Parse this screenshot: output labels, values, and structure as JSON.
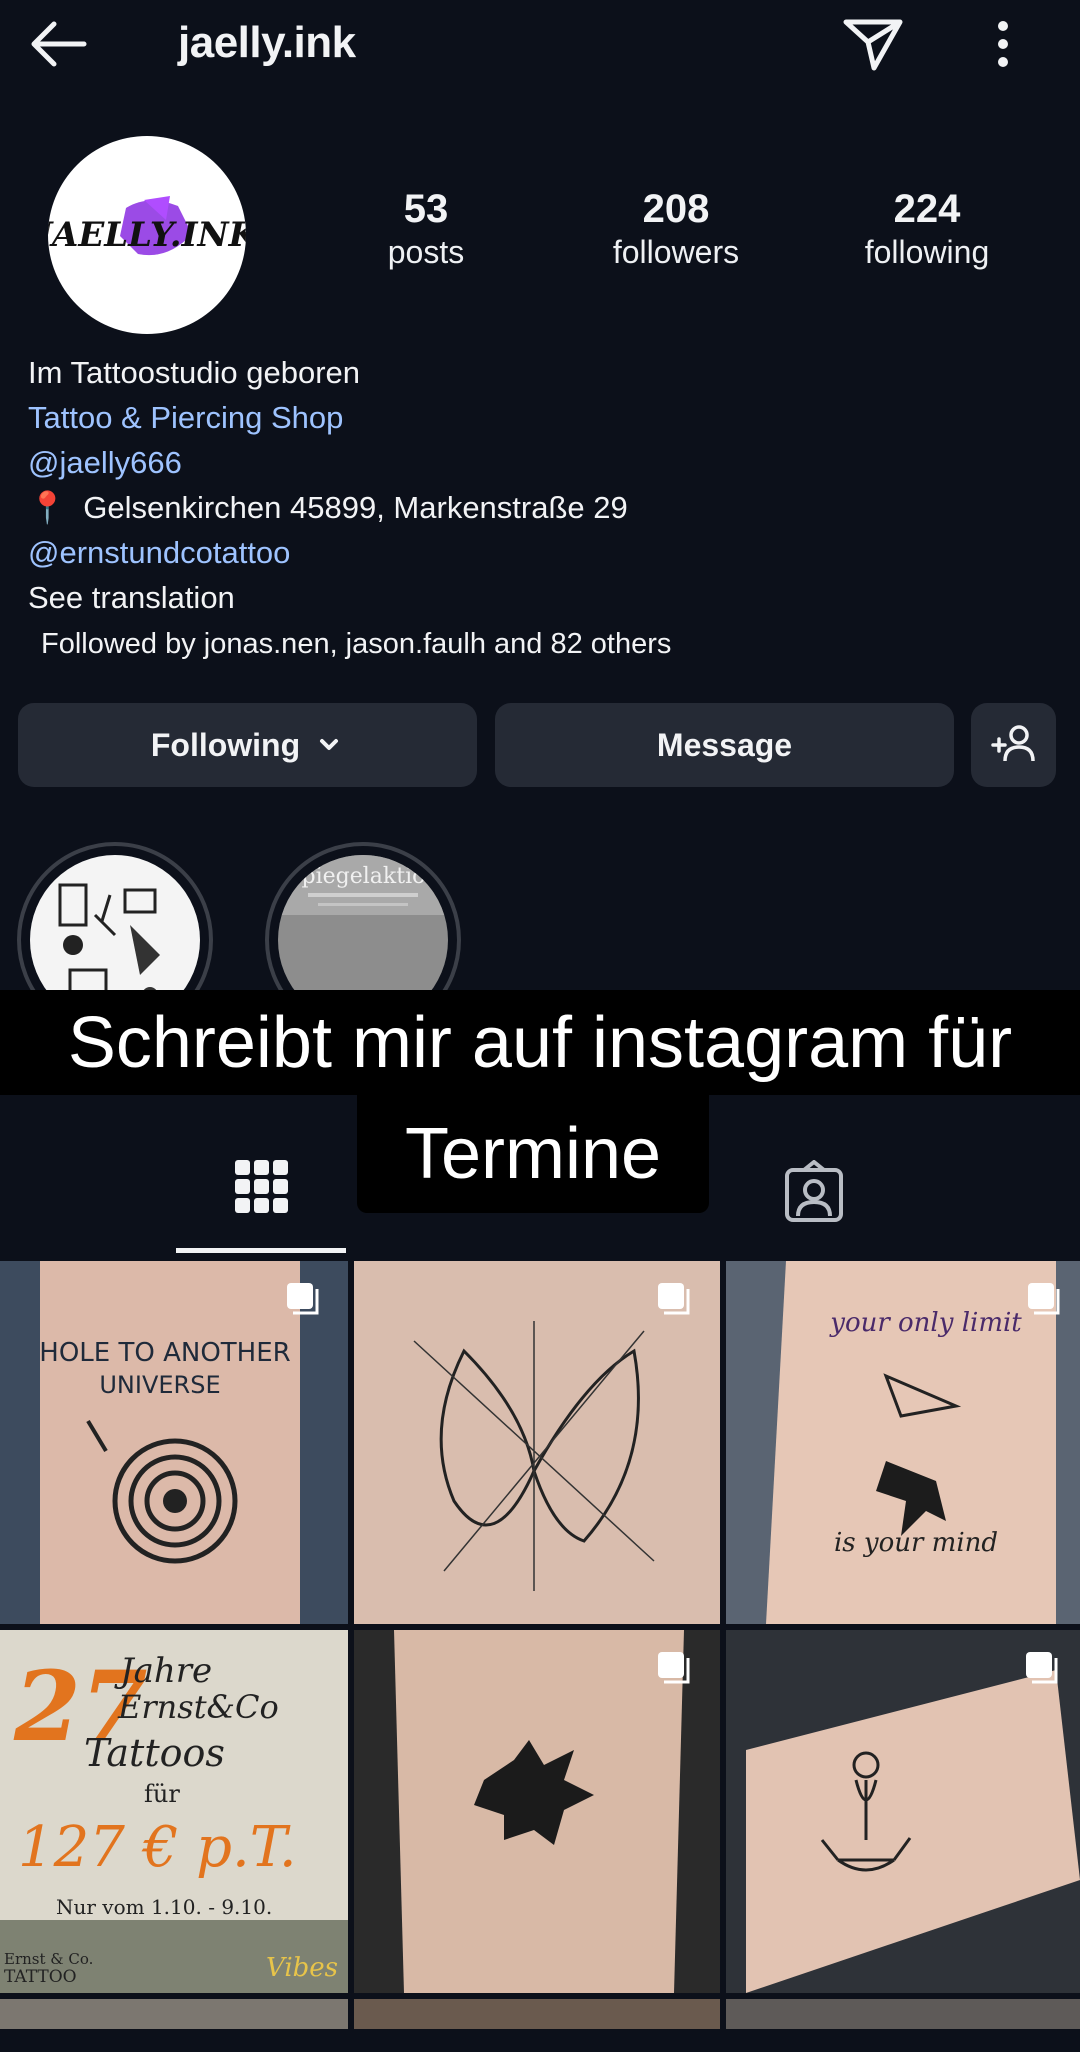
{
  "header": {
    "username": "jaelly.ink",
    "back_icon": "arrow-left-icon",
    "send_icon": "paper-plane-icon",
    "more_icon": "more-vertical-icon"
  },
  "avatar": {
    "logo_text": "JAELLY.INK"
  },
  "stats": {
    "posts": {
      "value": "53",
      "label": "posts"
    },
    "followers": {
      "value": "208",
      "label": "followers"
    },
    "following": {
      "value": "224",
      "label": "following"
    }
  },
  "bio": {
    "line1": "Im Tattoostudio geboren",
    "category": "Tattoo & Piercing Shop",
    "mention1": "@jaelly666",
    "location_pin": "📍",
    "location": "Gelsenkirchen 45899, Markenstraße 29",
    "mention2": "@ernstundcotattoo",
    "see_translation": "See translation"
  },
  "followed_by": "Followed by jonas.nen, jason.faulh and 82 others",
  "buttons": {
    "following": "Following",
    "message": "Message",
    "add_user_icon": "person-add-icon"
  },
  "highlights": [
    {
      "name": "highlight-sketches"
    },
    {
      "name": "highlight-spiegelaktion",
      "text": "Spiegelaktion"
    }
  ],
  "caption": {
    "line1": "Schreibt mir auf instagram für",
    "line2": "Termine"
  },
  "tabs": {
    "grid_icon": "grid-icon",
    "tagged_icon": "tagged-person-icon"
  },
  "posts": [
    {
      "text_top": "HOLE TO ANOTHER",
      "text_bottom": "UNIVERSE"
    },
    {
      "subject": "butterfly-cat"
    },
    {
      "text_top": "your only limit",
      "text_bottom": "is your mind"
    },
    {
      "line1": "27",
      "line2": "Jahre",
      "line3": "Ernst&Co",
      "line4": "Tattoos",
      "line5": "für",
      "line6": "127 € p.T.",
      "line7": "Nur vom 1.10. - 9.10.",
      "line8": "Ernst & Co.",
      "line9": "TATTOO",
      "line10": "Vibes"
    },
    {
      "subject": "silhouette"
    },
    {
      "subject": "meditating-figure"
    }
  ],
  "colors": {
    "background": "#0c101a",
    "button": "#252a35",
    "link": "#9ec3ff",
    "text": "#f2f3f5"
  }
}
